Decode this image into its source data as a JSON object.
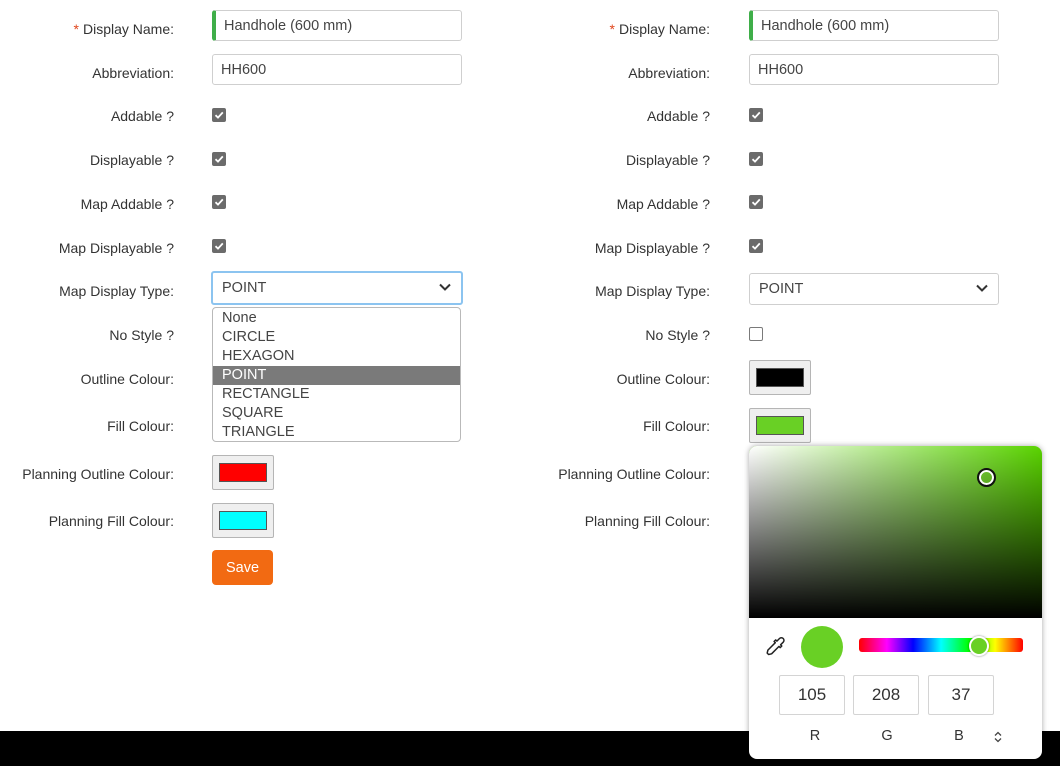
{
  "left_form": {
    "display_name": {
      "required_mark": "*",
      "label": "Display Name:",
      "value": "Handhole (600 mm)"
    },
    "abbreviation": {
      "label": "Abbreviation:",
      "value": "HH600"
    },
    "addable": {
      "label": "Addable ?",
      "checked": true
    },
    "displayable": {
      "label": "Displayable ?",
      "checked": true
    },
    "map_addable": {
      "label": "Map Addable ?",
      "checked": true
    },
    "map_displayable": {
      "label": "Map Displayable ?",
      "checked": true
    },
    "map_display_type": {
      "label": "Map Display Type:",
      "value": "POINT",
      "open": true,
      "options": [
        "None",
        "CIRCLE",
        "HEXAGON",
        "POINT",
        "RECTANGLE",
        "SQUARE",
        "TRIANGLE"
      ],
      "selected_index": 3
    },
    "no_style": {
      "label": "No Style ?"
    },
    "outline_colour": {
      "label": "Outline Colour:"
    },
    "fill_colour": {
      "label": "Fill Colour:"
    },
    "planning_outline_colour": {
      "label": "Planning Outline Colour:",
      "color": "#ff0000"
    },
    "planning_fill_colour": {
      "label": "Planning Fill Colour:",
      "color": "#00ffff"
    },
    "save_label": "Save"
  },
  "right_form": {
    "display_name": {
      "required_mark": "*",
      "label": "Display Name:",
      "value": "Handhole (600 mm)"
    },
    "abbreviation": {
      "label": "Abbreviation:",
      "value": "HH600"
    },
    "addable": {
      "label": "Addable ?",
      "checked": true
    },
    "displayable": {
      "label": "Displayable ?",
      "checked": true
    },
    "map_addable": {
      "label": "Map Addable ?",
      "checked": true
    },
    "map_displayable": {
      "label": "Map Displayable ?",
      "checked": true
    },
    "map_display_type": {
      "label": "Map Display Type:",
      "value": "POINT",
      "open": false
    },
    "no_style": {
      "label": "No Style ?",
      "checked": false
    },
    "outline_colour": {
      "label": "Outline Colour:",
      "color": "#000000"
    },
    "fill_colour": {
      "label": "Fill Colour:",
      "color": "#69d025"
    },
    "planning_outline_colour": {
      "label": "Planning Outline Colour:"
    },
    "planning_fill_colour": {
      "label": "Planning Fill Colour:"
    }
  },
  "color_picker": {
    "r": "105",
    "g": "208",
    "b": "37",
    "r_label": "R",
    "g_label": "G",
    "b_label": "B",
    "hue_color": "#5ad400",
    "current_color": "#69d025"
  },
  "colors": {
    "save_button": "#f26a12",
    "required_mark": "#e0451b",
    "valid_indicator": "#3fae49"
  }
}
